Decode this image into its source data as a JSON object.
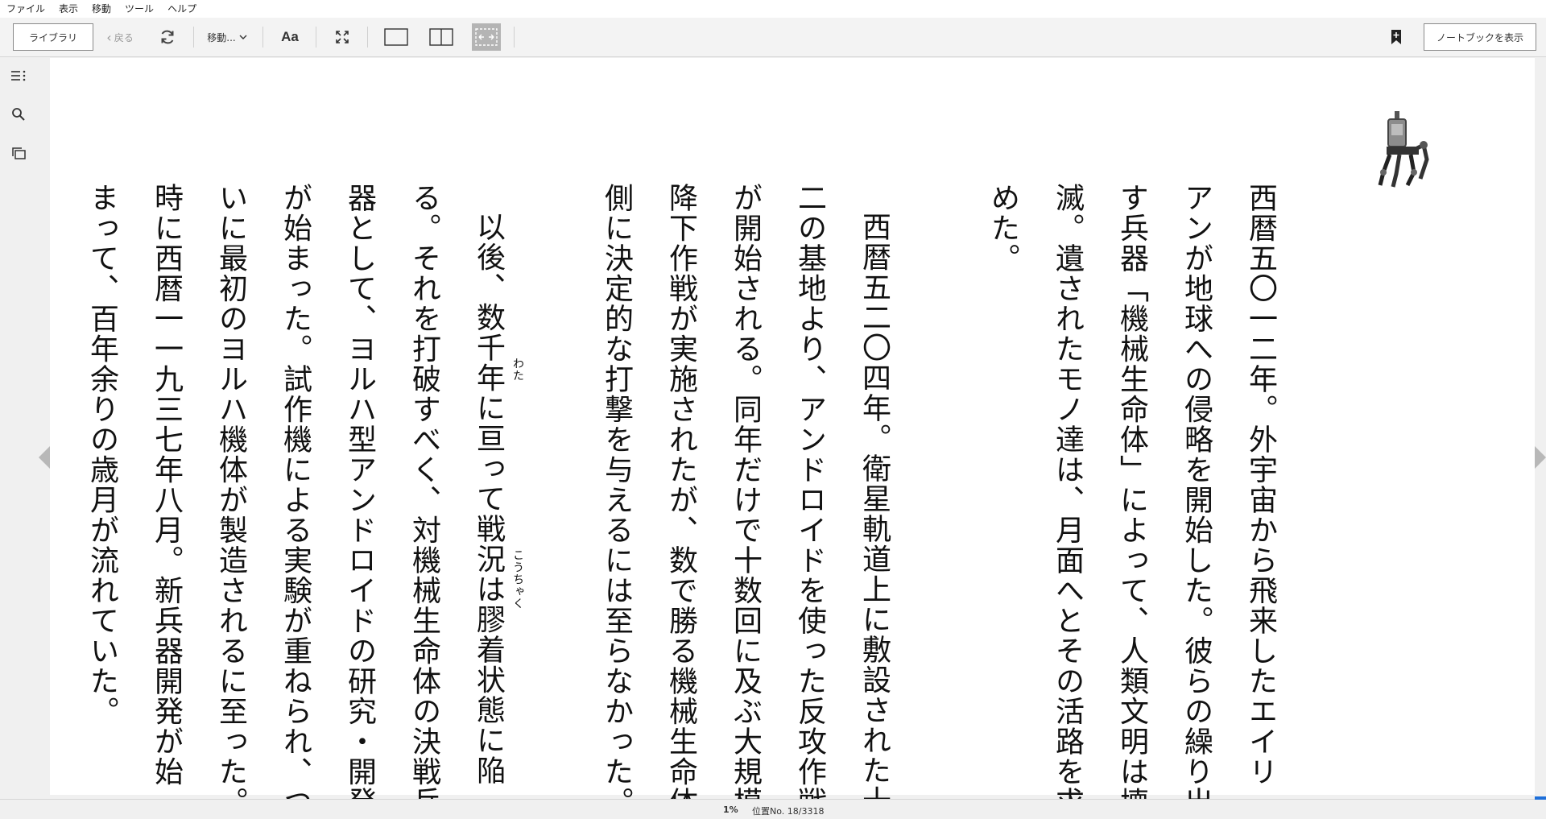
{
  "menu": {
    "items": [
      "ファイル",
      "表示",
      "移動",
      "ツール",
      "ヘルプ"
    ]
  },
  "toolbar": {
    "library_label": "ライブラリ",
    "back_label": "戻る",
    "goto_label": "移動...",
    "font_label": "Aa",
    "notebook_label": "ノートブックを表示"
  },
  "icons": {
    "refresh": "refresh-icon",
    "dropdown": "chevron-down-icon",
    "fullscreen": "fullscreen-icon",
    "single": "single-column-icon",
    "double": "two-column-icon",
    "fit": "fit-width-icon",
    "bookmark": "bookmark-add-icon",
    "toc": "table-of-contents-icon",
    "search": "search-icon",
    "flashcards": "flashcards-icon",
    "prev": "previous-page-icon",
    "next": "next-page-icon"
  },
  "reader": {
    "columns": [
      "西暦五〇一二年。外宇宙から飛来したエイリ",
      "アンが地球への侵略を開始した。彼らの繰り出",
      "す兵器「機械生命体」によって、人類文明は壊",
      "滅。遺されたモノ達は、月面へとその活路を求",
      "めた。",
      "西暦五二〇四年。衛星軌道上に敷設された十",
      "二の基地より、アンドロイドを使った反攻作戦",
      "が開始される。同年だけで十数回に及ぶ大規模",
      "降下作戦が実施されたが、数で勝る機械生命体",
      "側に決定的な打撃を与えるには至らなかった。",
      "以後、数千年に亘って戦況は膠着状態に陥",
      "る。それを打破すべく、対機械生命体の決戦兵",
      "器として、ヨルハ型アンドロイドの研究・開発",
      "が始まった。試作機による実験が重ねられ、つ",
      "いに最初のヨルハ機体が製造されるに至った。",
      "時に西暦一一九三七年八月。新兵器開発が始",
      "まって、百年余りの歳月が流れていた。"
    ],
    "furigana": [
      "わた",
      "こうちゃく"
    ]
  },
  "status": {
    "percent": "1%",
    "location": "位置No. 18/3318",
    "progress": 0.01
  },
  "colors": {
    "progress": "#1e6fd9",
    "active_tool": "#b4b4b4"
  }
}
